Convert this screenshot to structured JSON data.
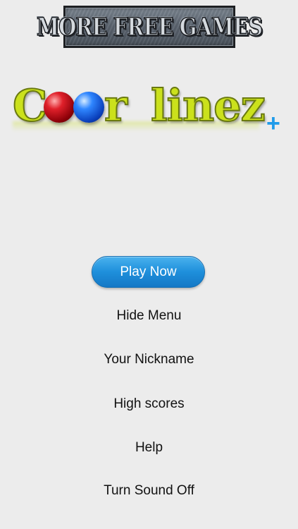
{
  "banner": {
    "text": "MORE FREE GAMES"
  },
  "logo": {
    "word1_c": "C",
    "word1_rest": "r",
    "word2": "linez",
    "plus": "+",
    "colors": {
      "letters": "#cbe11c",
      "red_ball": "#e0202a",
      "blue_ball": "#2f86ff",
      "plus": "#1f9bea"
    }
  },
  "menu": {
    "play_now": "Play Now",
    "hide_menu": "Hide Menu",
    "your_nickname": "Your Nickname",
    "high_scores": "High scores",
    "help": "Help",
    "turn_sound_off": "Turn Sound Off"
  },
  "colors": {
    "background": "#ececec",
    "accent_button": "#1e8fdb"
  }
}
